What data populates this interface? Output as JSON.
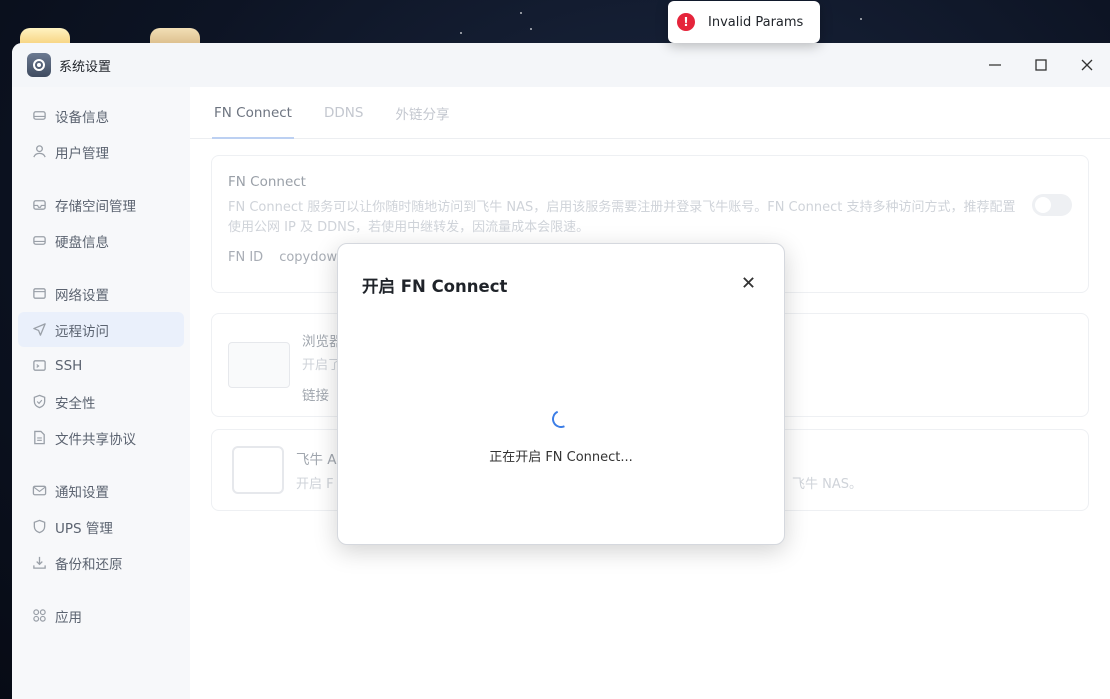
{
  "toast": {
    "icon": "error-icon",
    "text": "Invalid Params",
    "color": "#e5243b"
  },
  "window": {
    "title": "系统设置",
    "controls": [
      "minimize-icon",
      "maximize-icon",
      "close-icon"
    ]
  },
  "sidebar": {
    "items": [
      {
        "label": "设备信息",
        "icon": "device-icon"
      },
      {
        "label": "用户管理",
        "icon": "user-icon"
      },
      {
        "label": "存储空间管理",
        "icon": "storage-icon"
      },
      {
        "label": "硬盘信息",
        "icon": "disk-icon"
      },
      {
        "label": "网络设置",
        "icon": "network-icon"
      },
      {
        "label": "远程访问",
        "icon": "send-icon",
        "active": true
      },
      {
        "label": "SSH",
        "icon": "ssh-icon"
      },
      {
        "label": "安全性",
        "icon": "shield-icon"
      },
      {
        "label": "文件共享协议",
        "icon": "file-icon"
      },
      {
        "label": "通知设置",
        "icon": "mail-icon"
      },
      {
        "label": "UPS 管理",
        "icon": "ups-icon"
      },
      {
        "label": "备份和还原",
        "icon": "backup-icon"
      },
      {
        "label": "应用",
        "icon": "apps-icon"
      }
    ]
  },
  "tabs": [
    {
      "label": "FN Connect",
      "active": true
    },
    {
      "label": "DDNS"
    },
    {
      "label": "外链分享"
    }
  ],
  "fn_connect_card": {
    "title": "FN Connect",
    "description": "FN Connect 服务可以让你随时随地访问到飞牛 NAS，启用该服务需要注册并登录飞牛账号。FN Connect 支持多种访问方式，推荐配置使用公网 IP 及 DDNS，若使用中继转发，因流量成本会限速。",
    "fn_id_label": "FN ID",
    "fn_id_value": "copydow"
  },
  "browser_card": {
    "title": "浏览器",
    "sub": "开启了",
    "link_label": "链接"
  },
  "app_card": {
    "title": "飞牛 A",
    "sub": "开启 F",
    "tail": "飞牛 NAS。"
  },
  "modal": {
    "title": "开启 FN Connect",
    "message": "正在开启 FN Connect...",
    "accent": "#3b7de6"
  }
}
